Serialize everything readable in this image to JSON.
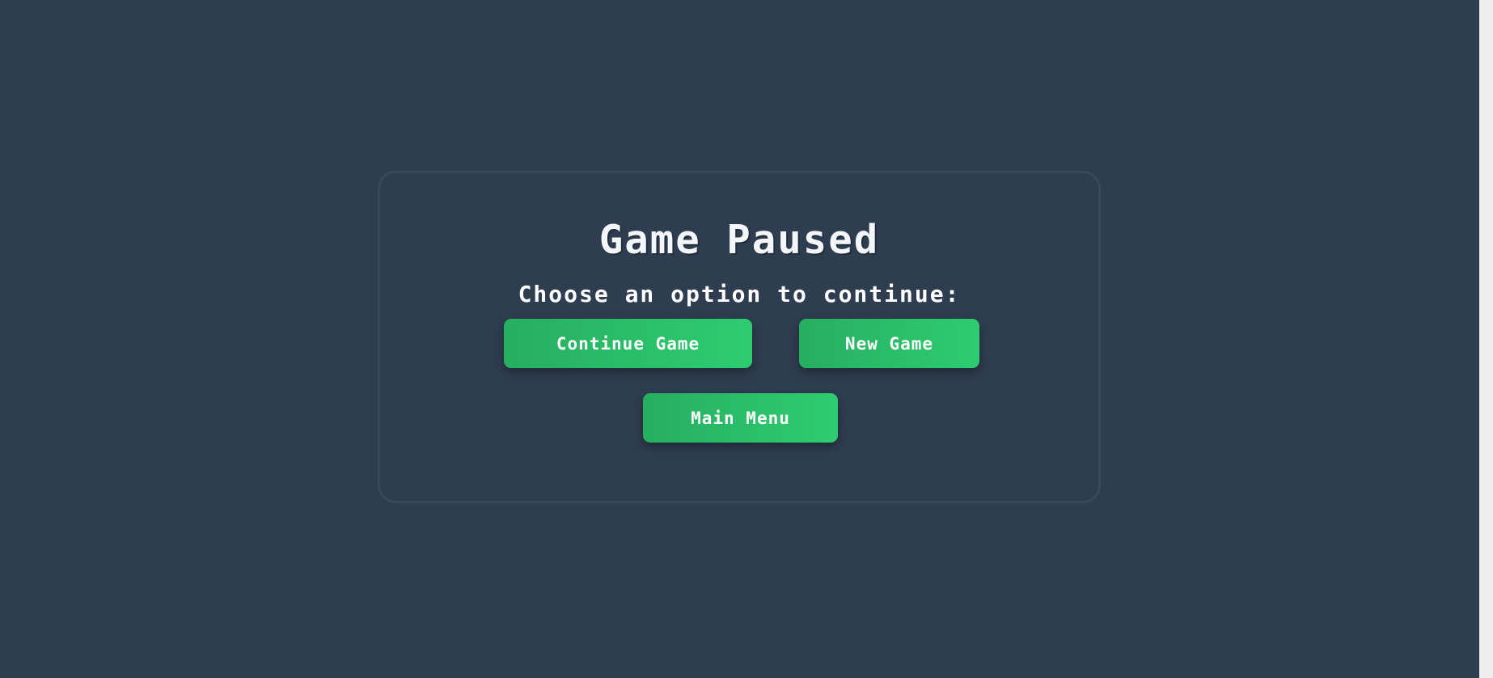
{
  "pause_menu": {
    "title": "Game Paused",
    "subtitle": "Choose an option to continue:",
    "buttons": {
      "continue_label": "Continue Game",
      "new_game_label": "New Game",
      "main_menu_label": "Main Menu"
    }
  },
  "colors": {
    "background": "#2e3d50",
    "panel_border": "#38495c",
    "button_gradient_start": "#27ae60",
    "button_gradient_end": "#2ecc71",
    "text": "#ffffff"
  }
}
